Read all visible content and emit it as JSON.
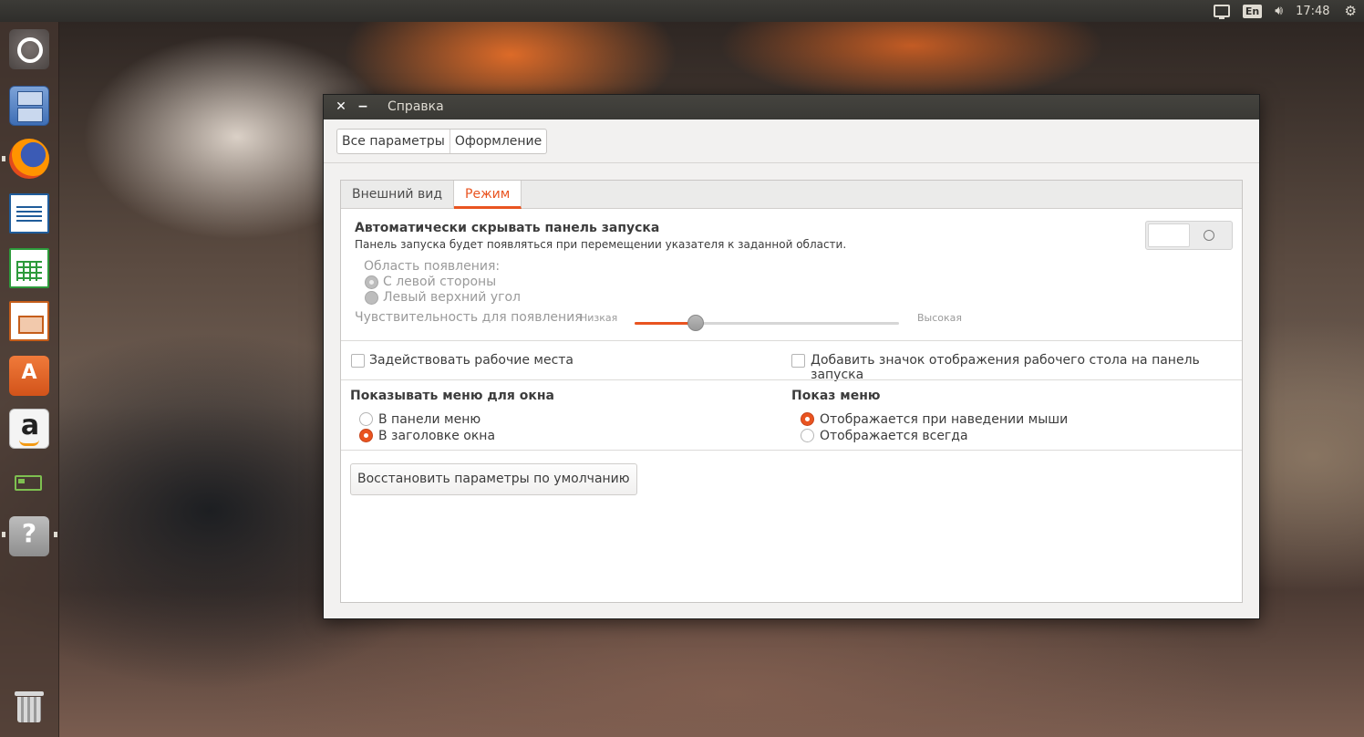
{
  "top_panel": {
    "network_icon": "network-icon",
    "keyboard_layout": "En",
    "sound_icon": "speaker-icon",
    "clock": "17:48",
    "system_icon": "gear-icon"
  },
  "launcher": {
    "items": [
      {
        "name": "ubuntu-dash",
        "icon": "ubuntu-logo-icon"
      },
      {
        "name": "files",
        "icon": "file-cabinet-icon"
      },
      {
        "name": "firefox",
        "icon": "firefox-icon"
      },
      {
        "name": "libreoffice-writer",
        "icon": "writer-icon"
      },
      {
        "name": "libreoffice-calc",
        "icon": "calc-icon"
      },
      {
        "name": "libreoffice-impress",
        "icon": "impress-icon"
      },
      {
        "name": "ubuntu-software",
        "icon": "software-bag-icon"
      },
      {
        "name": "amazon",
        "icon": "amazon-icon"
      },
      {
        "name": "system-monitor",
        "icon": "battery-icon"
      },
      {
        "name": "help",
        "icon": "help-icon"
      },
      {
        "name": "trash",
        "icon": "trash-icon"
      }
    ]
  },
  "window": {
    "title": "Справка",
    "close_glyph": "✕",
    "minimize_glyph": "−",
    "breadcrumbs": [
      "Все параметры",
      "Оформление"
    ],
    "tabs": [
      "Внешний вид",
      "Режим"
    ],
    "active_tab": "Режим",
    "accent_color": "#e95420",
    "autohide": {
      "title": "Автоматически скрывать панель запуска",
      "description": "Панель запуска будет появляться при перемещении указателя к заданной области.",
      "enabled": false,
      "reveal_area_label": "Область появления:",
      "reveal_options": [
        "С левой стороны",
        "Левый верхний угол"
      ],
      "reveal_selected": "С левой стороны",
      "sensitivity_label": "Чувствительность для появления",
      "sensitivity_low": "Низкая",
      "sensitivity_high": "Высокая",
      "sensitivity_value": 0.23
    },
    "workspaces_label": "Задействовать рабочие места",
    "workspaces_checked": false,
    "show_desktop_label": "Добавить значок отображения рабочего стола на панель запуска",
    "show_desktop_checked": false,
    "window_menu": {
      "title": "Показывать меню для окна",
      "options": [
        "В панели меню",
        "В заголовке окна"
      ],
      "selected": "В заголовке окна"
    },
    "menu_visibility": {
      "title": "Показ меню",
      "options": [
        "Отображается при наведении мыши",
        "Отображается всегда"
      ],
      "selected": "Отображается при наведении мыши"
    },
    "reset_button": "Восстановить параметры по умолчанию"
  }
}
